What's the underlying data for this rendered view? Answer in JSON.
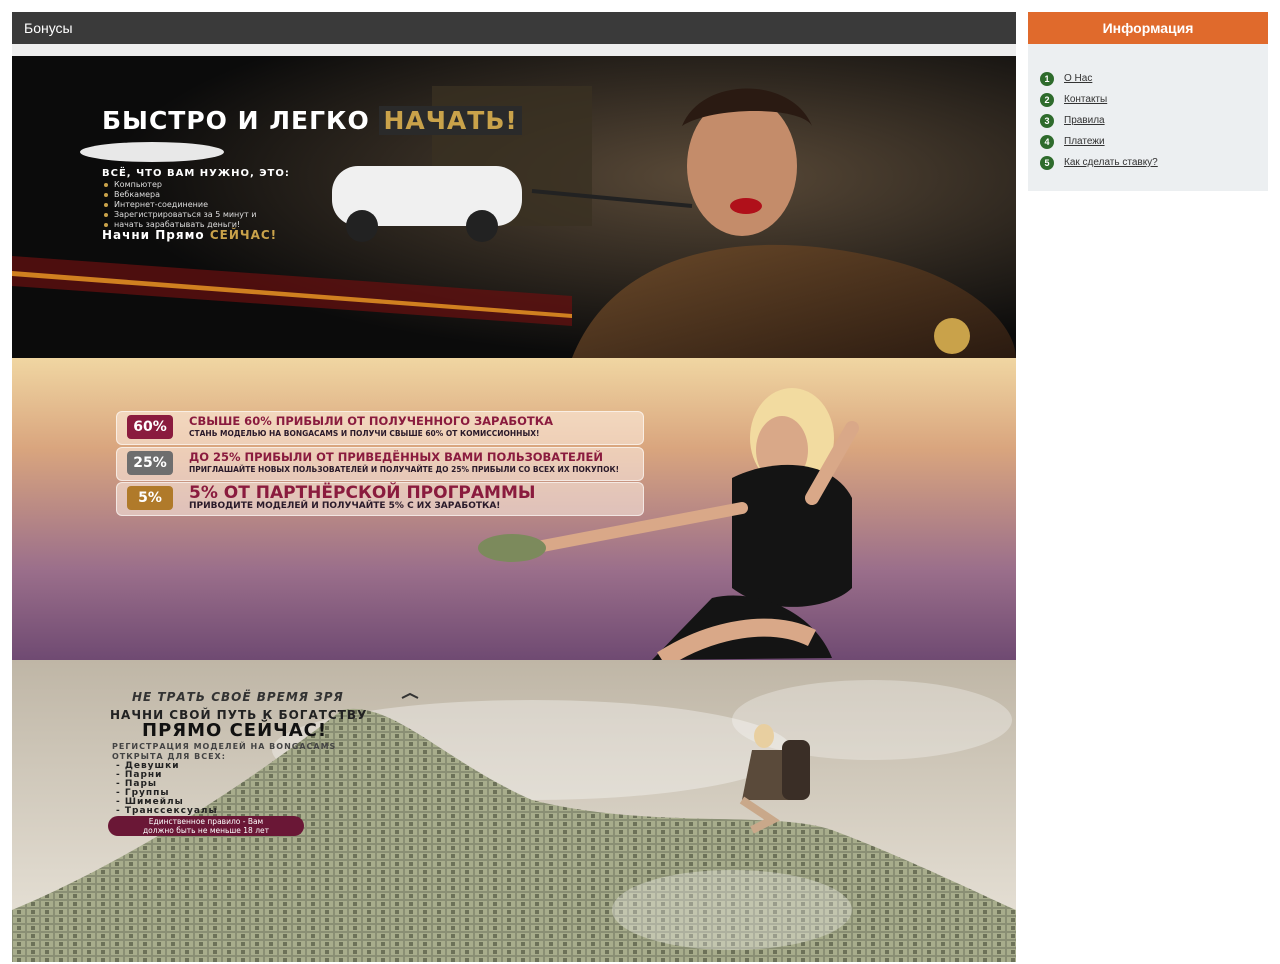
{
  "main": {
    "title": "Бонусы"
  },
  "banner1": {
    "headline": "БЫСТРО И ЛЕГКО",
    "headline_accent": "НАЧАТЬ!",
    "needs_title": "ВСЁ, ЧТО ВАМ НУЖНО, ЭТО:",
    "items": [
      "Компьютер",
      "Вебкамера",
      "Интернет-соединение",
      "Зарегистрироваться за 5 минут и",
      "начать зарабатывать деньги!"
    ],
    "cta": "Начни Прямо",
    "cta_accent": "СЕЙЧАС!"
  },
  "banner2": {
    "offers": [
      {
        "pct": "60%",
        "title": "СВЫШЕ 60% ПРИБЫЛИ ОТ ПОЛУЧЕННОГО ЗАРАБОТКА",
        "sub": "СТАНЬ МОДЕЛЬЮ НА BONGACAMS И ПОЛУЧИ СВЫШЕ 60% ОТ КОМИССИОННЫХ!"
      },
      {
        "pct": "25%",
        "title": "ДО 25% ПРИБЫЛИ ОТ ПРИВЕДЁННЫХ ВАМИ ПОЛЬЗОВАТЕЛЕЙ",
        "sub": "ПРИГЛАШАЙТЕ НОВЫХ ПОЛЬЗОВАТЕЛЕЙ И ПОЛУЧАЙТЕ ДО 25% ПРИБЫЛИ СО ВСЕХ ИХ ПОКУПОК!"
      },
      {
        "pct": "5%",
        "title": "5% ОТ ПАРТНЁРСКОЙ ПРОГРАММЫ",
        "sub": "ПРИВОДИТЕ МОДЕЛЕЙ И ПОЛУЧАЙТЕ 5% С ИХ ЗАРАБОТКА!"
      }
    ]
  },
  "banner3": {
    "line1": "НЕ ТРАТЬ СВОЁ ВРЕМЯ ЗРЯ",
    "line2": "НАЧНИ СВОЙ ПУТЬ К БОГАТСТВУ",
    "line3": "ПРЯМО СЕЙЧАС!",
    "line4": "РЕГИСТРАЦИЯ МОДЕЛЕЙ НА BONGACAMS",
    "line5": "ОТКРЫТА ДЛЯ ВСЕХ:",
    "items": [
      "- Девушки",
      "- Парни",
      "- Пары",
      "- Группы",
      "- Шимейлы",
      "- Транссексуалы"
    ],
    "rule1": "Единственное правило - Вам",
    "rule2": "должно быть не меньше 18 лет"
  },
  "sidebar": {
    "title": "Информация",
    "items": [
      {
        "num": "1",
        "label": "О Нас"
      },
      {
        "num": "2",
        "label": "Контакты"
      },
      {
        "num": "3",
        "label": "Правила"
      },
      {
        "num": "4",
        "label": "Платежи"
      },
      {
        "num": "5",
        "label": "Как сделать ставку?"
      }
    ]
  },
  "colors": {
    "header_bg": "#3a3a3a",
    "sidebar_header_bg": "#e06a2c",
    "sidebar_bg": "#eceff1",
    "number_badge": "#2e6b2c",
    "gold_accent": "#c9a24a"
  }
}
